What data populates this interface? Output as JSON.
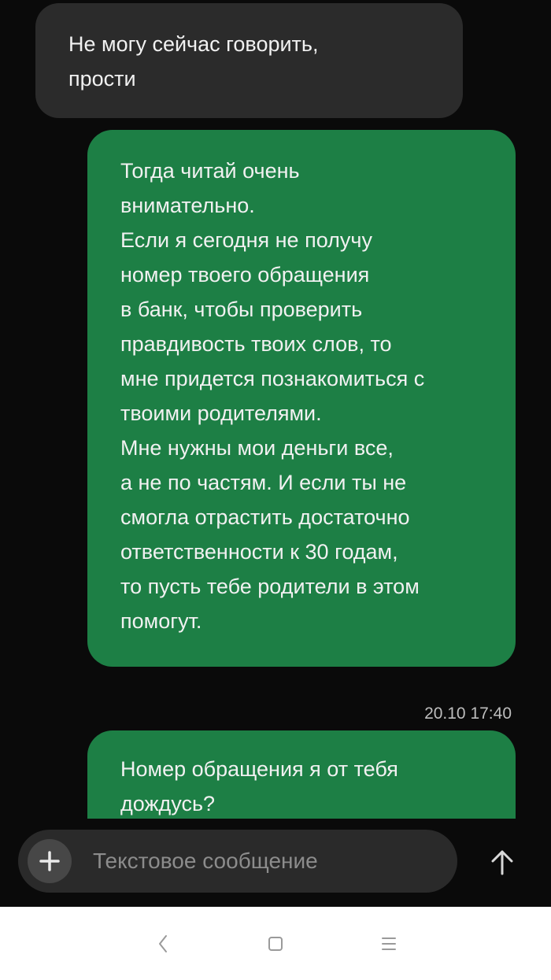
{
  "messages": {
    "incoming_1": "Не могу сейчас говорить,\nпрости",
    "outgoing_1": "Тогда читай очень\nвнимательно.\nЕсли я сегодня не получу\nномер твоего обращения\nв банк, чтобы проверить\nправдивость твоих слов, то\nмне придется познакомиться с\nтвоими родителями.\nМне нужны мои деньги все,\nа не по частям. И если ты не\nсмогла отрастить достаточно\nответственности к 30 годам,\nто пусть тебе родители в этом\nпомогут.",
    "timestamp": "20.10 17:40",
    "outgoing_2": "Номер обращения я от тебя\nдождусь?"
  },
  "composer": {
    "placeholder": "Текстовое сообщение",
    "plus_icon": "plus-icon",
    "send_icon": "arrow-up-icon"
  },
  "navigation": {
    "back_icon": "back-icon",
    "home_icon": "home-icon",
    "menu_icon": "menu-icon"
  },
  "colors": {
    "outgoing_bubble": "#1d7f45",
    "incoming_bubble": "#2b2b2b",
    "background": "#0a0a0a"
  }
}
